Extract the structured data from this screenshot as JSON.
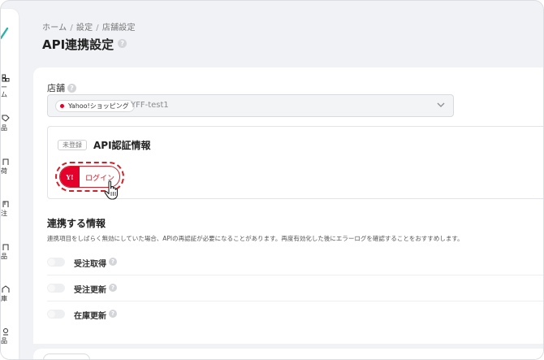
{
  "sidebar": {
    "items": [
      {
        "icon": "home-icon",
        "label": "ーム"
      },
      {
        "icon": "tag-icon",
        "label": "品"
      },
      {
        "icon": "box-icon",
        "label": "荷"
      },
      {
        "icon": "order-icon",
        "label": "注"
      },
      {
        "icon": "product-icon",
        "label": "品"
      },
      {
        "icon": "warehouse-icon",
        "label": "庫"
      },
      {
        "icon": "item-icon",
        "label": "品"
      }
    ]
  },
  "breadcrumb": {
    "home": "ホーム",
    "settings": "設定",
    "store_settings": "店舗設定",
    "sep": "/"
  },
  "page": {
    "title": "API連携設定",
    "help": "?"
  },
  "store": {
    "label": "店舗",
    "help": "?",
    "tag": "Yahoo!ショッピング",
    "value": "YFF-test1"
  },
  "auth": {
    "badge": "未登録",
    "title": "API認証情報",
    "logo_text": "Y!",
    "login_label": "ログイン"
  },
  "linked": {
    "title": "連携する情報",
    "description": "連携項目をしばらく無効にしていた場合、APIの再認証が必要になることがあります。再度有効化した後にエラーログを確認することをおすすめします。",
    "items": [
      {
        "label": "受注取得",
        "help": "?"
      },
      {
        "label": "受注更新",
        "help": "?"
      },
      {
        "label": "在庫更新",
        "help": "?"
      }
    ]
  },
  "colors": {
    "accent": "#d0202a",
    "yahoo_red": "#e4002b",
    "brand_teal": "#2bb3a3"
  }
}
